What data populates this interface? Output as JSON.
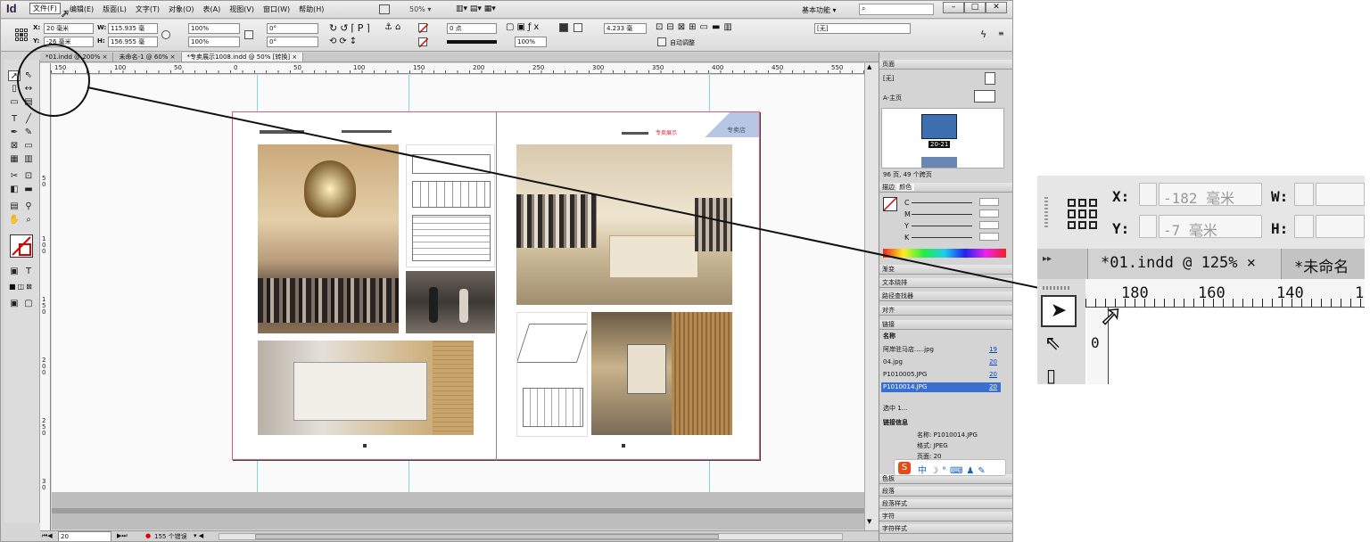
{
  "app": {
    "logo": "Id"
  },
  "menu": [
    "文件(F)",
    "编辑(E)",
    "版面(L)",
    "文字(T)",
    "对象(O)",
    "表(A)",
    "视图(V)",
    "窗口(W)",
    "帮助(H)"
  ],
  "menubar": {
    "zoom": "50% ▾",
    "workspace": "基本功能 ▾",
    "window_buttons": [
      "–",
      "□",
      "✕"
    ]
  },
  "control": {
    "x_label": "X:",
    "x_value": "20 毫米",
    "y_label": "Y:",
    "y_value": "-26 毫米",
    "w_label": "W:",
    "w_value": "115.935 毫",
    "h_label": "H:",
    "h_value": "156.955 毫",
    "scale_x": "100%",
    "scale_y": "100%",
    "rotate": "0°",
    "shear": "0°",
    "stroke": "0 点",
    "percent": "100%",
    "offset": "4.233 毫",
    "auto_fit": "自动调整",
    "style": "[无]"
  },
  "tabs": [
    "*01.indd @ 200% ×",
    "未命名-1 @ 60% ×",
    "*专卖展示1008.indd @ 50% [转换] ×"
  ],
  "hruler": [
    "150",
    "100",
    "50",
    "0",
    "50",
    "100",
    "150",
    "200",
    "250",
    "300",
    "350",
    "400",
    "450",
    "550"
  ],
  "vruler": [
    "5 0",
    "1 0 0",
    "1 5 0",
    "2 0 0",
    "2 5 0",
    "3 0"
  ],
  "spread": {
    "brand": "专卖展示",
    "corner_label": "专卖店"
  },
  "status": {
    "page": "20",
    "errors": "155 个错误"
  },
  "panels": {
    "pages_title": "页面",
    "none_master": "[无]",
    "a_master": "A-主页",
    "spread_label": "20-21",
    "pages_footer": "96 页, 49 个跨页",
    "stroke_tab": "描边",
    "color_tab": "颜色",
    "cmyk": [
      "C",
      "M",
      "Y",
      "K"
    ],
    "gradient": "渐变",
    "text_wrap": "文本绕排",
    "pathfinder": "路径查找器",
    "align": "对齐",
    "links": "链接",
    "links_col_name": "名称",
    "links_rows": [
      {
        "name": "阿岸驻马店.....jpg",
        "page": "19"
      },
      {
        "name": "04.jpg",
        "page": "20"
      },
      {
        "name": "P1010005.JPG",
        "page": "20"
      },
      {
        "name": "P1010014.JPG",
        "page": "20"
      }
    ],
    "links_footer": "选中 1...",
    "link_info_title": "链接信息",
    "link_info": {
      "name": "名称: P1010014.JPG",
      "format": "格式: JPEG",
      "page": "页面: 20"
    },
    "bottom": [
      "色板",
      "段落",
      "段落样式",
      "字符",
      "字符样式"
    ]
  },
  "zoom_callout": {
    "x_label": "X:",
    "x_value": "-182 毫米",
    "y_label": "Y:",
    "y_value": "-7 毫米",
    "w_label": "W:",
    "h_label": "H:",
    "tab1": "*01.indd @ 125% ×",
    "tab2": "*未命名",
    "ruler": [
      "180",
      "160",
      "140",
      "1"
    ],
    "vruler": "0"
  }
}
